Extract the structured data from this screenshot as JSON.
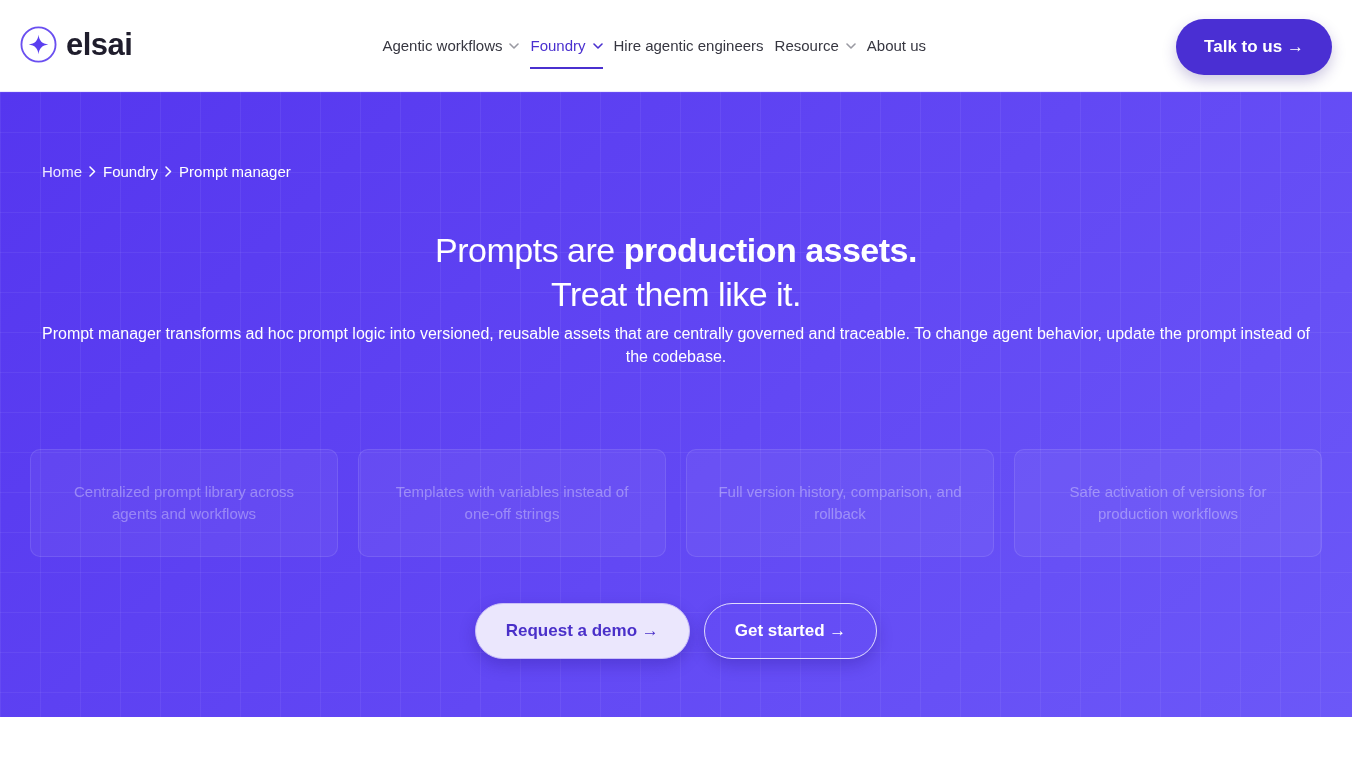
{
  "header": {
    "logo": {
      "text": "elsai"
    },
    "nav": [
      {
        "label": "Agentic workflows",
        "dropdown": true,
        "selected": false
      },
      {
        "label": "Foundry",
        "dropdown": true,
        "selected": true
      },
      {
        "label": "Hire agentic engineers",
        "dropdown": false,
        "selected": false
      },
      {
        "label": "Resource",
        "dropdown": true,
        "selected": false
      },
      {
        "label": "About us",
        "dropdown": false,
        "selected": false
      }
    ],
    "cta": "Talk to us →"
  },
  "hero": {
    "breadcrumb": [
      {
        "label": "Home"
      },
      {
        "label": "Foundry"
      },
      {
        "label": "Prompt manager"
      }
    ],
    "headline": [
      "Prompts are **production assets.**",
      "Treat them like it."
    ],
    "description": "Prompt manager transforms ad hoc prompt logic into versioned, reusable assets that are centrally governed and traceable. To change agent behavior, update the prompt instead of the codebase.",
    "features": [
      "Centralized prompt library across agents and workflows",
      "Templates with variables instead of one-off strings",
      "Full version history, comparison, and rollback",
      "Safe activation of versions for production workflows"
    ],
    "buttons": [
      {
        "label": "Request a demo →",
        "kind": "primary"
      },
      {
        "label": "Get started →",
        "kind": "outline"
      }
    ]
  }
}
